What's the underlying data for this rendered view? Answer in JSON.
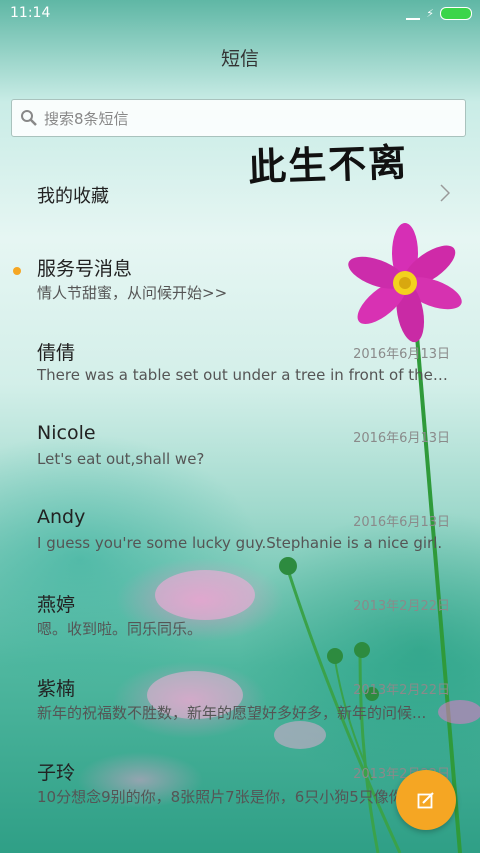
{
  "status_bar": {
    "time": "11:14"
  },
  "header": {
    "title": "短信"
  },
  "search": {
    "placeholder": "搜索8条短信"
  },
  "watermark": {
    "text": "此生不离"
  },
  "favorites": {
    "label": "我的收藏"
  },
  "conversations": [
    {
      "name": "服务号消息",
      "date": "",
      "preview": "情人节甜蜜，从问候开始>>",
      "unread": true
    },
    {
      "name": "倩倩",
      "date": "2016年6月13日",
      "preview": "There was a table set out under a tree in front of the ho..."
    },
    {
      "name": "Nicole",
      "date": "2016年6月13日",
      "preview": "Let's eat out,shall we?"
    },
    {
      "name": "Andy",
      "date": "2016年6月13日",
      "preview": "I guess you're some lucky guy.Stephanie is a nice girl."
    },
    {
      "name": "燕婷",
      "date": "2013年2月22日",
      "preview": "嗯。收到啦。同乐同乐。"
    },
    {
      "name": "紫楠",
      "date": "2013年2月22日",
      "preview": "新年的祝福数不胜数，新年的愿望好多好多，新年的问候..."
    },
    {
      "name": "子玲",
      "date": "2013年2月22日",
      "preview": "10分想念9别的你，8张照片7张是你，6只小狗5只像你..."
    }
  ],
  "icons": {
    "search": "search-icon",
    "chevron": "chevron-right-icon",
    "compose": "compose-icon"
  },
  "colors": {
    "accent": "#f5a623",
    "battery": "#3bd54a"
  }
}
